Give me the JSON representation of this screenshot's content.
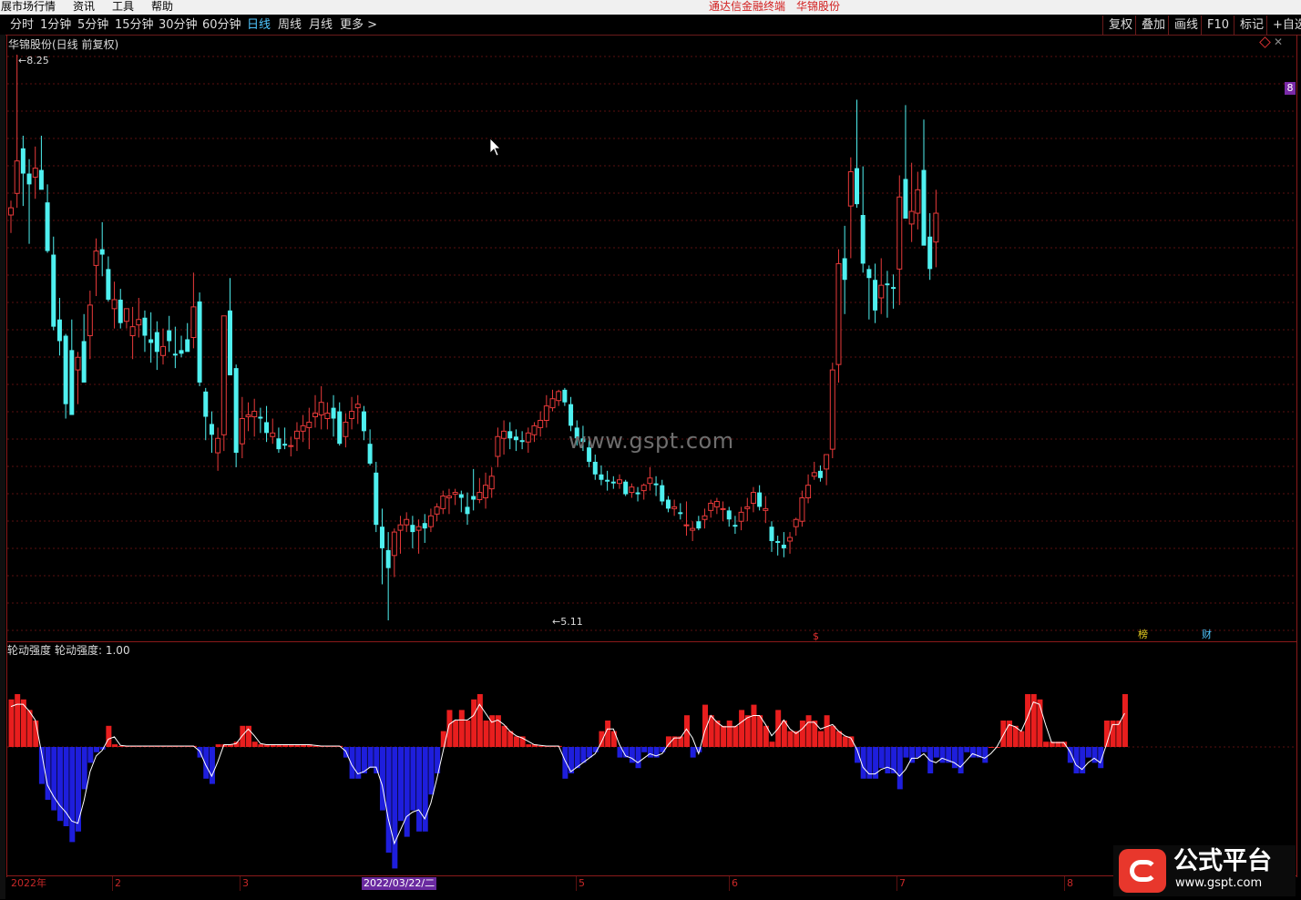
{
  "menubar": {
    "items": [
      "展市场行情",
      "资讯",
      "工具",
      "帮助"
    ],
    "title_left": "通达信金融终端",
    "title_right": "华锦股份"
  },
  "toolbar": {
    "periods": [
      "分时",
      "1分钟",
      "5分钟",
      "15分钟",
      "30分钟",
      "60分钟",
      "日线",
      "周线",
      "月线",
      "更多 >"
    ],
    "active_index": 6,
    "right_buttons": [
      "复权",
      "叠加",
      "画线",
      "F10",
      "标记",
      "+自选"
    ]
  },
  "main_chart": {
    "title": "华锦股份(日线 前复权)",
    "high_label": "8.25",
    "low_label": "5.11",
    "right_tag": "8",
    "markers": [
      "$",
      "榜",
      "财"
    ]
  },
  "indicator": {
    "title": "轮动强度",
    "value_label": "轮动强度: 1.00"
  },
  "watermark": "www.gspt.com",
  "date_axis": {
    "ticks": [
      "2022年",
      "2",
      "3",
      "5",
      "6",
      "7",
      "8"
    ],
    "highlight": "2022/03/22/二"
  },
  "brand": {
    "name": "公式平台",
    "url": "www.gspt.com"
  },
  "colors": {
    "up": "#e83a3a",
    "down": "#4ff0f0",
    "neg": "#1e1edc",
    "pos": "#e81e1e",
    "line": "#ffffff"
  },
  "chart_data": {
    "type": "candlestick",
    "series": [
      {
        "name": "K",
        "ohlc": [
          [
            7.36,
            7.44,
            7.26,
            7.4
          ],
          [
            7.48,
            8.25,
            7.4,
            7.66
          ],
          [
            7.73,
            7.8,
            7.41,
            7.59
          ],
          [
            7.59,
            7.67,
            7.2,
            7.53
          ],
          [
            7.57,
            7.74,
            7.45,
            7.62
          ],
          [
            7.61,
            7.8,
            7.52,
            7.5
          ],
          [
            7.43,
            7.53,
            7.15,
            7.16
          ],
          [
            7.14,
            7.24,
            6.72,
            6.74
          ],
          [
            6.78,
            6.9,
            6.58,
            6.66
          ],
          [
            6.69,
            6.7,
            6.23,
            6.31
          ],
          [
            6.61,
            6.78,
            6.33,
            6.25
          ],
          [
            6.5,
            6.6,
            6.31,
            6.57
          ],
          [
            6.66,
            6.81,
            6.54,
            6.43
          ],
          [
            6.69,
            6.94,
            6.56,
            6.86
          ],
          [
            7.08,
            7.23,
            6.91,
            7.16
          ],
          [
            7.17,
            7.32,
            7.02,
            7.14
          ],
          [
            7.06,
            7.13,
            6.88,
            6.89
          ],
          [
            6.84,
            6.99,
            6.73,
            6.89
          ],
          [
            6.89,
            6.95,
            6.73,
            6.76
          ],
          [
            6.77,
            6.83,
            6.73,
            6.84
          ],
          [
            6.69,
            6.85,
            6.56,
            6.74
          ],
          [
            6.75,
            6.9,
            6.68,
            6.78
          ],
          [
            6.79,
            6.83,
            6.6,
            6.69
          ],
          [
            6.67,
            6.82,
            6.54,
            6.65
          ],
          [
            6.71,
            6.77,
            6.5,
            6.6
          ],
          [
            6.58,
            6.73,
            6.53,
            6.63
          ],
          [
            6.72,
            6.8,
            6.6,
            6.66
          ],
          [
            6.59,
            6.74,
            6.51,
            6.58
          ],
          [
            6.61,
            6.69,
            6.57,
            6.59
          ],
          [
            6.67,
            6.76,
            6.61,
            6.6
          ],
          [
            6.68,
            7.04,
            6.62,
            6.85
          ],
          [
            6.88,
            6.93,
            6.41,
            6.43
          ],
          [
            6.38,
            6.4,
            6.11,
            6.24
          ],
          [
            6.2,
            6.27,
            6.04,
            6.14
          ],
          [
            6.04,
            6.18,
            5.94,
            6.12
          ],
          [
            6.14,
            6.36,
            6.05,
            6.8
          ],
          [
            6.83,
            7.01,
            6.62,
            6.47
          ],
          [
            6.51,
            6.53,
            5.96,
            6.04
          ],
          [
            6.09,
            6.35,
            6.01,
            6.23
          ],
          [
            6.24,
            6.32,
            6.16,
            6.25
          ],
          [
            6.24,
            6.34,
            6.13,
            6.27
          ],
          [
            6.24,
            6.29,
            6.15,
            6.23
          ],
          [
            6.21,
            6.3,
            6.1,
            6.15
          ],
          [
            6.13,
            6.23,
            6.09,
            6.15
          ],
          [
            6.12,
            6.18,
            6.04,
            6.06
          ],
          [
            6.09,
            6.18,
            6.06,
            6.08
          ],
          [
            6.08,
            6.13,
            6.02,
            6.08
          ],
          [
            6.12,
            6.21,
            6.05,
            6.16
          ],
          [
            6.16,
            6.25,
            6.1,
            6.19
          ],
          [
            6.18,
            6.29,
            6.06,
            6.21
          ],
          [
            6.24,
            6.36,
            6.18,
            6.26
          ],
          [
            6.25,
            6.41,
            6.17,
            6.32
          ],
          [
            6.23,
            6.32,
            6.17,
            6.26
          ],
          [
            6.29,
            6.36,
            6.13,
            6.23
          ],
          [
            6.27,
            6.32,
            6.08,
            6.09
          ],
          [
            6.13,
            6.26,
            6.07,
            6.21
          ],
          [
            6.23,
            6.35,
            6.17,
            6.27
          ],
          [
            6.29,
            6.36,
            6.2,
            6.31
          ],
          [
            6.27,
            6.3,
            6.11,
            6.16
          ],
          [
            6.09,
            6.17,
            5.97,
            5.98
          ],
          [
            5.93,
            5.99,
            5.6,
            5.64
          ],
          [
            5.63,
            5.73,
            5.31,
            5.51
          ],
          [
            5.5,
            5.6,
            5.11,
            5.4
          ],
          [
            5.47,
            5.62,
            5.35,
            5.6
          ],
          [
            5.61,
            5.69,
            5.48,
            5.64
          ],
          [
            5.64,
            5.71,
            5.6,
            5.67
          ],
          [
            5.64,
            5.69,
            5.51,
            5.6
          ],
          [
            5.61,
            5.67,
            5.48,
            5.63
          ],
          [
            5.65,
            5.7,
            5.54,
            5.62
          ],
          [
            5.63,
            5.73,
            5.6,
            5.69
          ],
          [
            5.7,
            5.76,
            5.66,
            5.74
          ],
          [
            5.73,
            5.83,
            5.7,
            5.8
          ],
          [
            5.79,
            5.84,
            5.7,
            5.8
          ],
          [
            5.81,
            5.84,
            5.75,
            5.82
          ],
          [
            5.81,
            5.83,
            5.71,
            5.79
          ],
          [
            5.74,
            5.82,
            5.64,
            5.7
          ],
          [
            5.8,
            5.95,
            5.72,
            5.78
          ],
          [
            5.78,
            5.9,
            5.76,
            5.82
          ],
          [
            5.79,
            5.93,
            5.73,
            5.86
          ],
          [
            5.84,
            5.96,
            5.79,
            5.91
          ],
          [
            6.02,
            6.18,
            5.96,
            6.13
          ],
          [
            6.12,
            6.22,
            6.03,
            6.16
          ],
          [
            6.16,
            6.21,
            6.06,
            6.12
          ],
          [
            6.13,
            6.17,
            6.05,
            6.11
          ],
          [
            6.11,
            6.16,
            6.06,
            6.1
          ],
          [
            6.1,
            6.18,
            6.04,
            6.15
          ],
          [
            6.14,
            6.21,
            6.1,
            6.19
          ],
          [
            6.18,
            6.27,
            6.13,
            6.22
          ],
          [
            6.22,
            6.36,
            6.18,
            6.3
          ],
          [
            6.29,
            6.39,
            6.27,
            6.34
          ],
          [
            6.33,
            6.39,
            6.3,
            6.38
          ],
          [
            6.39,
            6.4,
            6.3,
            6.32
          ],
          [
            6.31,
            6.35,
            6.16,
            6.19
          ],
          [
            6.18,
            6.22,
            6.08,
            6.12
          ],
          [
            6.12,
            6.19,
            6.05,
            6.1
          ],
          [
            6.07,
            6.11,
            5.96,
            5.99
          ],
          [
            5.99,
            6.03,
            5.89,
            5.92
          ],
          [
            5.92,
            5.97,
            5.86,
            5.89
          ],
          [
            5.89,
            5.94,
            5.83,
            5.88
          ],
          [
            5.88,
            5.91,
            5.84,
            5.87
          ],
          [
            5.87,
            5.92,
            5.84,
            5.89
          ],
          [
            5.88,
            5.89,
            5.8,
            5.81
          ],
          [
            5.82,
            5.87,
            5.79,
            5.85
          ],
          [
            5.82,
            5.85,
            5.77,
            5.81
          ],
          [
            5.83,
            5.87,
            5.78,
            5.86
          ],
          [
            5.87,
            5.96,
            5.83,
            5.9
          ],
          [
            5.87,
            5.91,
            5.8,
            5.86
          ],
          [
            5.86,
            5.89,
            5.75,
            5.77
          ],
          [
            5.78,
            5.8,
            5.71,
            5.73
          ],
          [
            5.73,
            5.78,
            5.69,
            5.74
          ],
          [
            5.71,
            5.76,
            5.67,
            5.7
          ],
          [
            5.64,
            5.77,
            5.58,
            5.64
          ],
          [
            5.61,
            5.66,
            5.55,
            5.62
          ],
          [
            5.66,
            5.69,
            5.61,
            5.62
          ],
          [
            5.67,
            5.73,
            5.62,
            5.69
          ],
          [
            5.72,
            5.78,
            5.68,
            5.76
          ],
          [
            5.74,
            5.79,
            5.7,
            5.77
          ],
          [
            5.73,
            5.77,
            5.66,
            5.73
          ],
          [
            5.72,
            5.74,
            5.63,
            5.67
          ],
          [
            5.64,
            5.69,
            5.59,
            5.63
          ],
          [
            5.66,
            5.74,
            5.61,
            5.71
          ],
          [
            5.73,
            5.79,
            5.66,
            5.74
          ],
          [
            5.76,
            5.85,
            5.71,
            5.82
          ],
          [
            5.82,
            5.86,
            5.72,
            5.74
          ],
          [
            5.72,
            5.8,
            5.65,
            5.73
          ],
          [
            5.63,
            5.66,
            5.49,
            5.55
          ],
          [
            5.55,
            5.58,
            5.47,
            5.54
          ],
          [
            5.53,
            5.6,
            5.46,
            5.51
          ],
          [
            5.55,
            5.6,
            5.48,
            5.57
          ],
          [
            5.63,
            5.68,
            5.58,
            5.67
          ],
          [
            5.66,
            5.83,
            5.63,
            5.79
          ],
          [
            5.79,
            5.92,
            5.76,
            5.86
          ],
          [
            5.91,
            5.99,
            5.89,
            5.93
          ],
          [
            5.94,
            5.97,
            5.88,
            5.9
          ],
          [
            5.95,
            6.02,
            5.86,
            6.03
          ],
          [
            6.06,
            6.54,
            6.01,
            6.5
          ],
          [
            6.53,
            7.17,
            6.43,
            7.09
          ],
          [
            7.12,
            7.3,
            6.81,
            7.0
          ],
          [
            7.41,
            7.68,
            7.12,
            7.6
          ],
          [
            7.62,
            8.0,
            7.4,
            7.42
          ],
          [
            7.36,
            7.63,
            7.04,
            7.09
          ],
          [
            7.06,
            7.08,
            6.78,
            7.01
          ],
          [
            7.0,
            7.09,
            6.76,
            6.83
          ],
          [
            6.9,
            7.12,
            6.81,
            6.97
          ],
          [
            6.98,
            7.05,
            6.79,
            6.97
          ],
          [
            6.96,
            7.03,
            6.84,
            6.95
          ],
          [
            7.06,
            7.58,
            6.86,
            7.46
          ],
          [
            7.56,
            7.97,
            7.45,
            7.34
          ],
          [
            7.31,
            7.65,
            7.21,
            7.38
          ],
          [
            7.37,
            7.6,
            7.28,
            7.5
          ],
          [
            7.61,
            7.89,
            7.42,
            7.19
          ],
          [
            7.24,
            7.37,
            7.0,
            7.06
          ],
          [
            7.21,
            7.5,
            7.07,
            7.37
          ]
        ]
      },
      {
        "name": "轮动强度",
        "values": [
          0.9,
          1.0,
          0.9,
          0.7,
          0.5,
          -0.7,
          -1.0,
          -1.2,
          -1.4,
          -1.5,
          -1.8,
          -1.6,
          -0.8,
          -0.3,
          -0.1,
          -0.05,
          0.4,
          0.05,
          0.02,
          0.02,
          0.02,
          0.02,
          0.02,
          0.02,
          0.02,
          0.02,
          0.02,
          0.02,
          0.02,
          0.02,
          0.02,
          -0.2,
          -0.6,
          -0.7,
          0.05,
          0.05,
          0.05,
          0.1,
          0.4,
          0.4,
          0.1,
          0.05,
          0.05,
          0.05,
          0.05,
          0.05,
          0.05,
          0.05,
          0.05,
          0.05,
          0.02,
          0.02,
          0.02,
          0.02,
          0.02,
          -0.2,
          -0.6,
          -0.6,
          -0.5,
          -0.4,
          -0.5,
          -1.2,
          -2.0,
          -2.3,
          -1.4,
          -1.7,
          -1.2,
          -1.6,
          -1.6,
          -0.9,
          -0.5,
          0.3,
          0.7,
          0.5,
          0.7,
          0.5,
          0.9,
          1.0,
          0.5,
          0.6,
          0.6,
          0.4,
          0.3,
          0.2,
          0.2,
          0.05,
          0.05,
          0.02,
          0.02,
          0.02,
          0.02,
          -0.6,
          -0.5,
          -0.4,
          -0.3,
          -0.2,
          -0.1,
          0.3,
          0.5,
          0.3,
          -0.2,
          -0.2,
          -0.3,
          -0.4,
          -0.1,
          -0.2,
          -0.2,
          -0.1,
          0.2,
          0.2,
          0.2,
          0.6,
          -0.2,
          -0.1,
          0.8,
          0.6,
          0.5,
          0.4,
          0.5,
          0.4,
          0.7,
          0.6,
          0.8,
          0.6,
          0.4,
          0.1,
          0.7,
          0.5,
          0.3,
          0.3,
          0.5,
          0.6,
          0.5,
          0.3,
          0.6,
          0.4,
          0.3,
          0.2,
          0.2,
          -0.3,
          -0.6,
          -0.6,
          -0.6,
          -0.4,
          -0.5,
          -0.5,
          -0.8,
          -0.2,
          -0.3,
          -0.2,
          -0.1,
          -0.5,
          -0.2,
          -0.3,
          -0.3,
          -0.4,
          -0.5,
          -0.1,
          -0.2,
          -0.2,
          -0.3,
          0.0,
          0.0,
          0.5,
          0.5,
          0.4,
          0.3,
          1.0,
          1.0,
          0.9,
          0.1,
          0.1,
          0.1,
          0.1,
          -0.3,
          -0.5,
          -0.5,
          -0.2,
          -0.3,
          -0.4,
          0.5,
          0.5,
          0.5,
          1.0
        ]
      }
    ],
    "price_range": [
      5.11,
      8.25
    ],
    "grid": "dotted-horizontal"
  }
}
